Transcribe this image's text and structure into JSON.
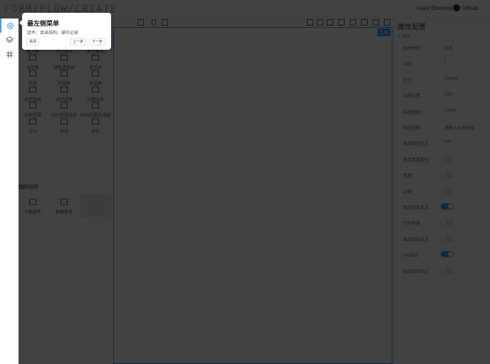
{
  "header": {
    "logo": "FORM/FLOW/CREATE",
    "vue_element": "Vue2 Element",
    "github": "Github"
  },
  "rail": {
    "items": [
      {
        "icon": "gear-icon"
      },
      {
        "icon": "layers-icon"
      },
      {
        "icon": "hash-icon"
      }
    ]
  },
  "components": [
    {
      "label": "输入框",
      "icon": "input-icon"
    },
    {
      "label": "多行输入",
      "icon": "textarea-icon"
    },
    {
      "label": "数字输入",
      "icon": "number-icon"
    },
    {
      "label": "选择框",
      "icon": "select-icon"
    },
    {
      "label": "级联选择器",
      "icon": "cascader-icon"
    },
    {
      "label": "单选框",
      "icon": "radio-icon"
    },
    {
      "label": "开关",
      "icon": "switch-icon"
    },
    {
      "label": "多选框",
      "icon": "checkbox-icon"
    },
    {
      "label": "复选框",
      "icon": "check-icon"
    },
    {
      "label": "树形选择",
      "icon": "tree-icon"
    },
    {
      "label": "时间选择",
      "icon": "time-icon"
    },
    {
      "label": "日期选择",
      "icon": "date-icon"
    },
    {
      "label": "日期范围",
      "icon": "calendar-icon"
    },
    {
      "label": "时间范围选择",
      "icon": "sort-icon"
    },
    {
      "label": "时间范围选择器",
      "icon": "datetime-icon"
    },
    {
      "label": "评分",
      "icon": "star-icon"
    },
    {
      "label": "滑块",
      "icon": "slider-icon"
    },
    {
      "label": "颜色",
      "icon": "color-icon"
    }
  ],
  "group": {
    "title": "辅助组件"
  },
  "aux_components": [
    {
      "label": "计数组件",
      "icon": "calc-icon"
    },
    {
      "label": "数据表单",
      "icon": "table-icon"
    }
  ],
  "canvas": {
    "tag": "工具"
  },
  "config": {
    "title": "属性配置",
    "subtitle": "表单",
    "rows": [
      {
        "key": "组件类型",
        "value": "表单"
      },
      {
        "key": "字段",
        "value": "f"
      },
      {
        "key": "尺寸",
        "value": "default"
      },
      {
        "key": "标签位置",
        "value": "right"
      },
      {
        "key": "标签宽度",
        "value": "100px"
      },
      {
        "key": "标签后缀",
        "value": "请输入标签后缀"
      },
      {
        "key": "表单提交方式",
        "value": "left"
      },
      {
        "key": "表单重置按钮",
        "switch": false
      },
      {
        "key": "禁用",
        "switch": false
      },
      {
        "key": "必填",
        "switch": false
      },
      {
        "key": "错误信息显示",
        "switch": true
      },
      {
        "key": "行内表单",
        "switch": false
      },
      {
        "key": "显示图标显示",
        "switch": false
      },
      {
        "key": "Info提示",
        "switch": true
      },
      {
        "key": "校验实时验证",
        "switch": false
      }
    ]
  },
  "tour": {
    "title": "最左侧菜单",
    "desc": "组件、目录结构、操作记录",
    "close": "关闭",
    "prev": "上一步",
    "next": "下一步"
  }
}
